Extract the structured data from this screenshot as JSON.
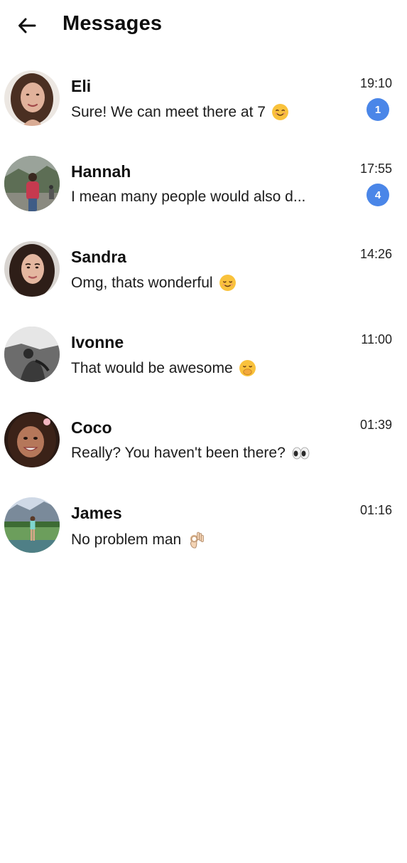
{
  "header": {
    "back_icon": "arrow-left-icon",
    "title": "Messages"
  },
  "colors": {
    "badge": "#4a86e8",
    "text": "#111111",
    "background": "#ffffff"
  },
  "conversations": [
    {
      "name": "Eli",
      "preview": "Sure! We can meet there at 7",
      "emoji": "smiling-face-icon",
      "time": "19:10",
      "unread": "1"
    },
    {
      "name": "Hannah",
      "preview": "I mean many people would also d...",
      "emoji": "",
      "time": "17:55",
      "unread": "4"
    },
    {
      "name": "Sandra",
      "preview": "Omg, thats wonderful",
      "emoji": "relieved-face-icon",
      "time": "14:26",
      "unread": ""
    },
    {
      "name": "Ivonne",
      "preview": "That would be awesome",
      "emoji": "hand-over-mouth-face-icon",
      "time": "11:00",
      "unread": ""
    },
    {
      "name": "Coco",
      "preview": "Really? You haven't been there?",
      "emoji": "eyes-icon",
      "time": "01:39",
      "unread": ""
    },
    {
      "name": "James",
      "preview": "No problem man",
      "emoji": "ok-hand-icon",
      "time": "01:16",
      "unread": ""
    }
  ]
}
